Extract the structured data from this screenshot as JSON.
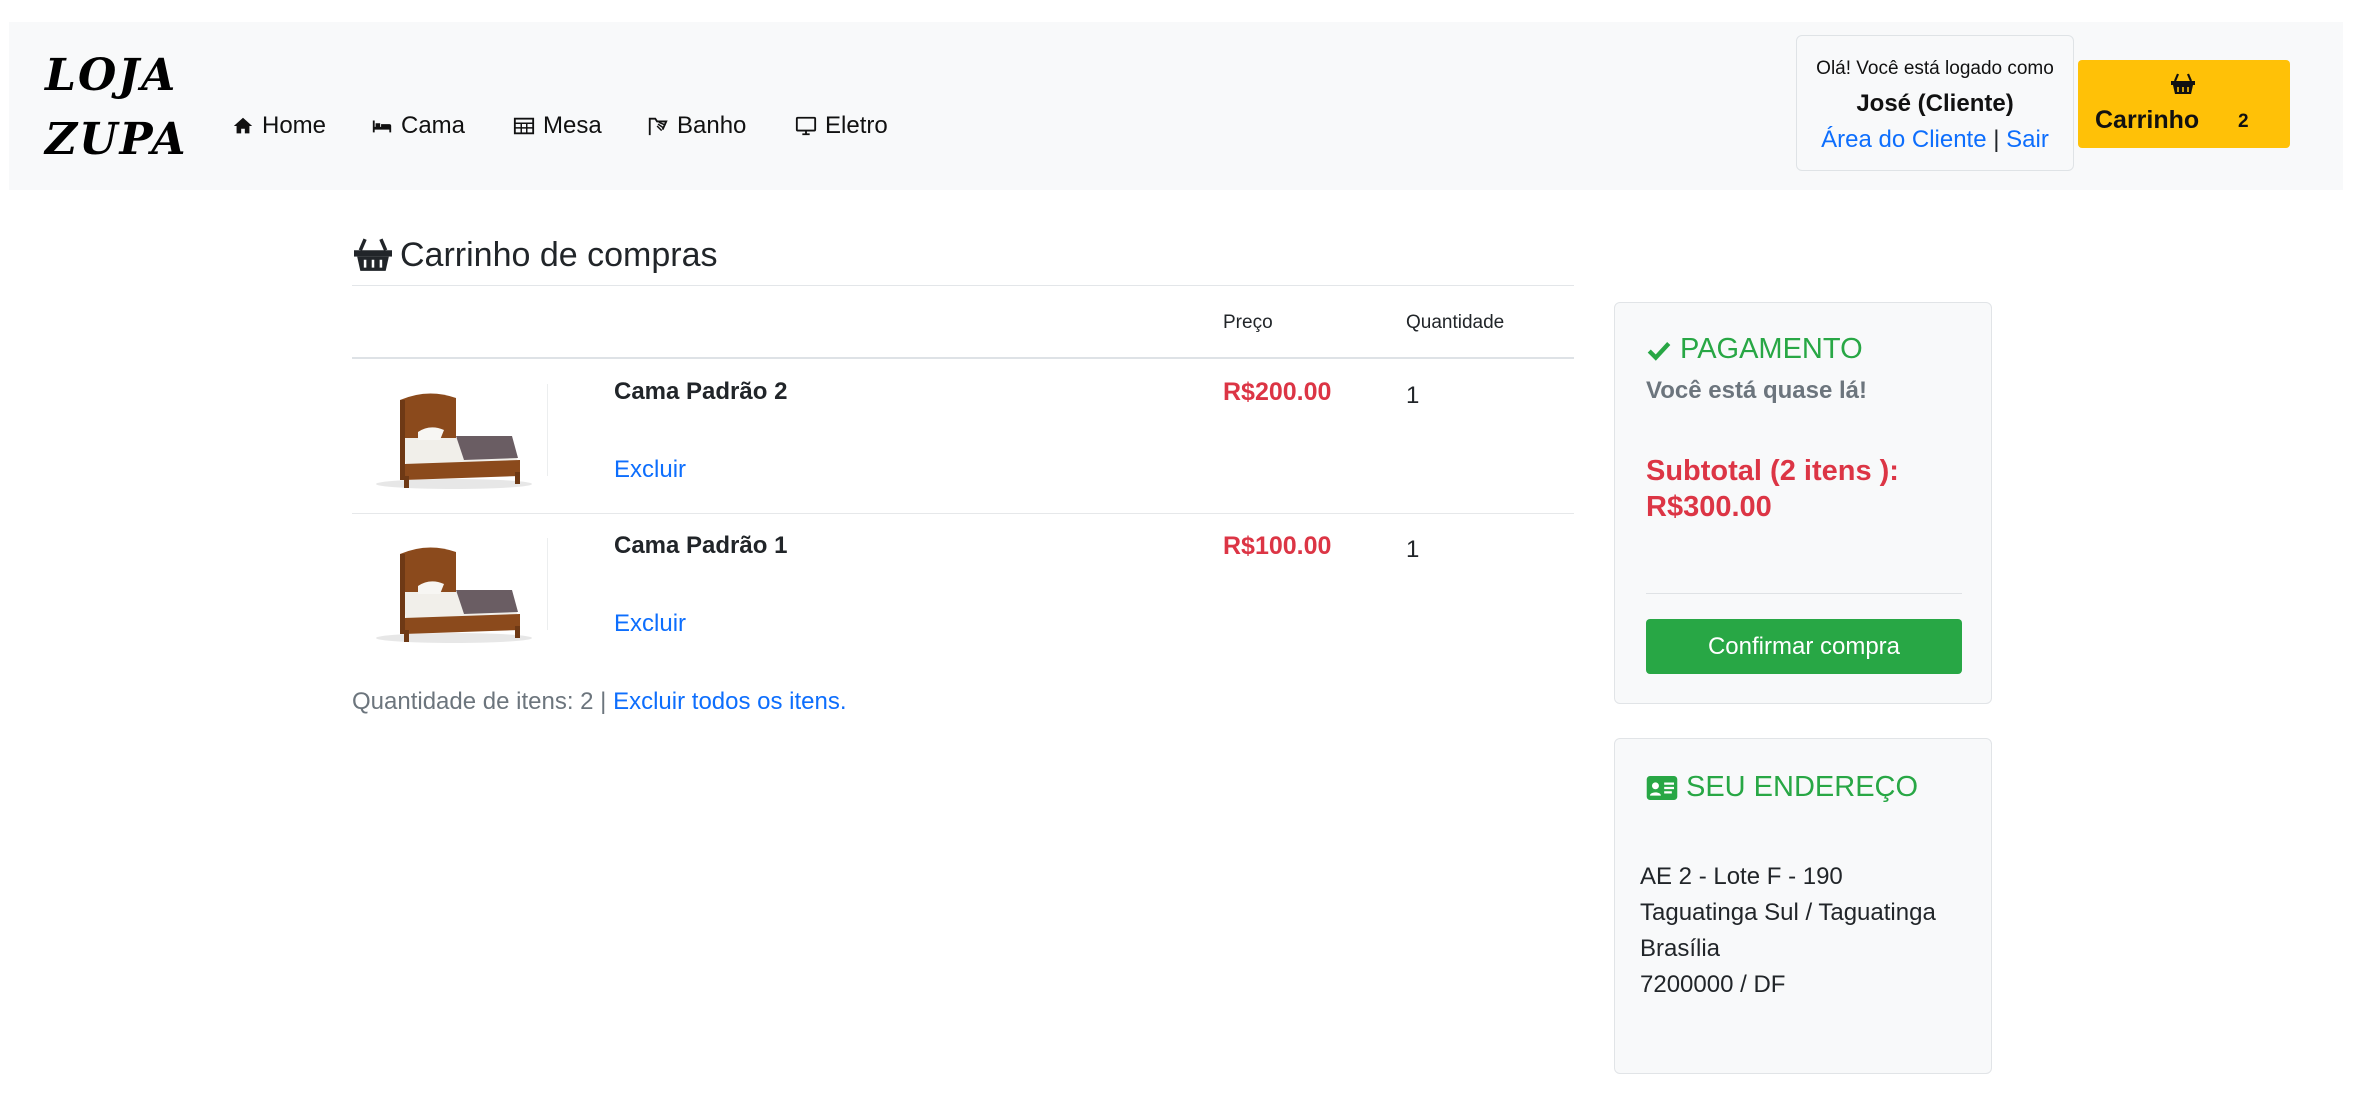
{
  "brand": {
    "line1": "LOJA",
    "line2": "ZUPA"
  },
  "nav": {
    "items": [
      {
        "label": "Home",
        "icon": "home-icon"
      },
      {
        "label": "Cama",
        "icon": "bed-icon"
      },
      {
        "label": "Mesa",
        "icon": "table-icon"
      },
      {
        "label": "Banho",
        "icon": "shower-icon"
      },
      {
        "label": "Eletro",
        "icon": "desktop-icon"
      }
    ]
  },
  "user": {
    "greeting": "Olá! Você está logado como",
    "name": "José (Cliente)",
    "area_link": "Área do Cliente",
    "separator": "|",
    "logout_link": "Sair"
  },
  "cart_button": {
    "label": "Carrinho",
    "count": "2",
    "icon": "basket-icon",
    "color": "#ffc107"
  },
  "cart": {
    "title": "Carrinho de compras",
    "headers": {
      "price": "Preço",
      "quantity": "Quantidade"
    },
    "items": [
      {
        "name": "Cama Padrão 2",
        "price": "R$200.00",
        "quantity": "1",
        "remove": "Excluir"
      },
      {
        "name": "Cama Padrão 1",
        "price": "R$100.00",
        "quantity": "1",
        "remove": "Excluir"
      }
    ],
    "summary_prefix": "Quantidade de itens: 2 |",
    "remove_all": "Excluir todos os itens."
  },
  "payment": {
    "title": "PAGAMENTO",
    "subtitle": "Você está quase lá!",
    "subtotal_label": "Subtotal (2 itens ):",
    "subtotal_value": "R$300.00",
    "confirm": "Confirmar compra"
  },
  "address": {
    "title": "SEU ENDEREÇO",
    "lines": [
      "AE 2 - Lote F - 190",
      "Taguatinga Sul / Taguatinga",
      "Brasília",
      "7200000 / DF"
    ]
  },
  "colors": {
    "success": "#28a745",
    "danger": "#dc3545",
    "link": "#0d6efd",
    "warning": "#ffc107"
  }
}
